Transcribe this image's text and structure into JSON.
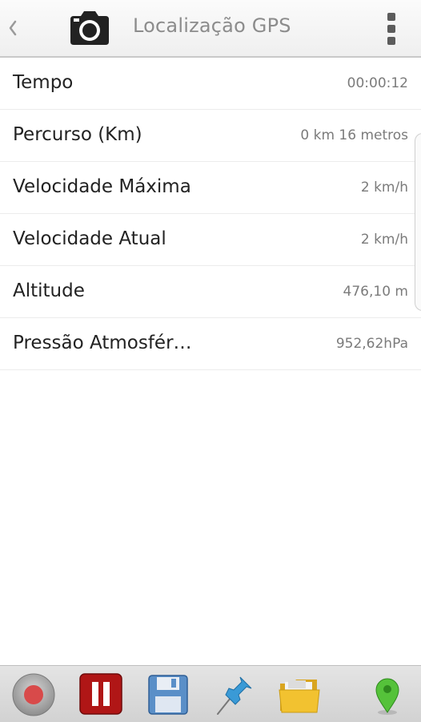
{
  "header": {
    "title": "Localização GPS",
    "back_icon": "chevron-left-icon",
    "camera_icon": "camera-icon",
    "menu_icon": "overflow-menu-icon"
  },
  "rows": [
    {
      "label": "Tempo",
      "value": "00:00:12"
    },
    {
      "label": "Percurso (Km)",
      "value": "0 km 16 metros"
    },
    {
      "label": "Velocidade Máxima",
      "value": "2 km/h"
    },
    {
      "label": "Velocidade Atual",
      "value": "2 km/h"
    },
    {
      "label": "Altitude",
      "value": "476,10 m"
    },
    {
      "label": "Pressão Atmosfér…",
      "value": "952,62hPa"
    }
  ],
  "toolbar": {
    "buttons": [
      "record-icon",
      "pause-icon",
      "save-icon",
      "pin-icon",
      "folder-icon",
      "map-marker-icon"
    ]
  },
  "colors": {
    "record": "#d84a4a",
    "pause": "#b01616",
    "save": "#5a8fc8",
    "pin": "#3a9ad6",
    "folder": "#f2c230",
    "marker": "#55c23a"
  }
}
